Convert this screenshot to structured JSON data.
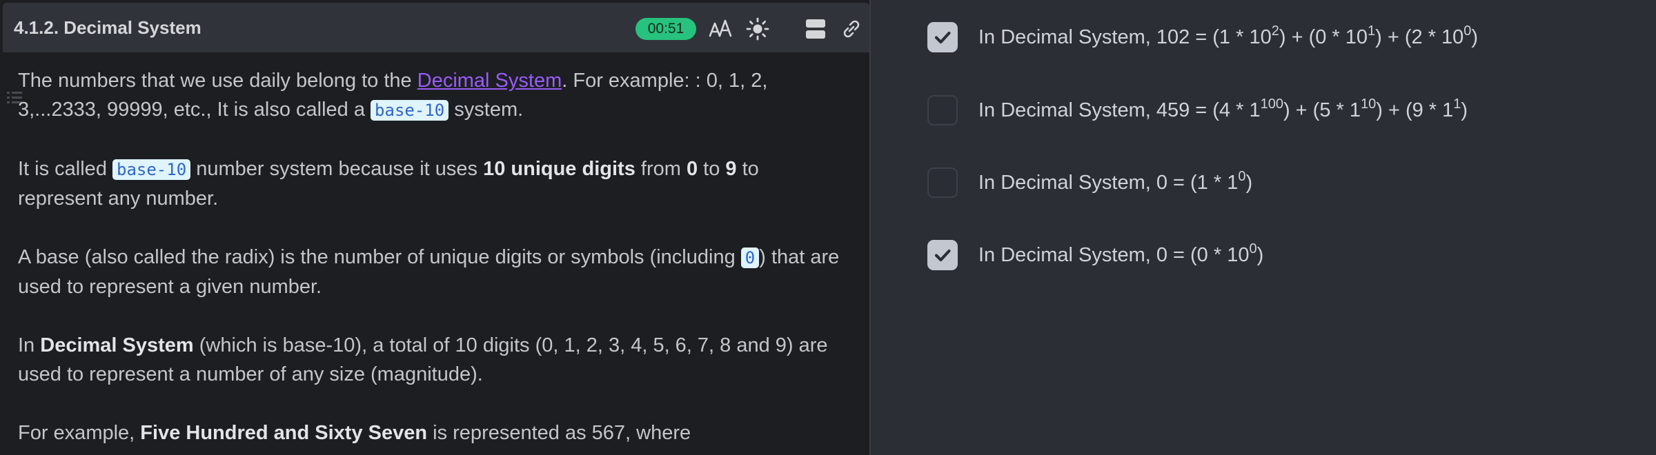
{
  "header": {
    "title": "4.1.2. Decimal System",
    "timer": "00:51",
    "icons": [
      "font-size-icon",
      "theme-sun-icon",
      "layout-icon",
      "link-icon"
    ]
  },
  "content": {
    "p1": {
      "t1": "The numbers that we use daily belong to the ",
      "link": "Decimal System",
      "t2": ". For example: : 0, 1, 2, 3,...2333, 99999, etc., It is also called a ",
      "code": "base-10",
      "t3": " system."
    },
    "p2": {
      "t1": "It is called ",
      "code": "base-10",
      "t2": " number system because it uses ",
      "b1": "10 unique digits",
      "t3": " from ",
      "b2": "0",
      "t4": " to ",
      "b3": "9",
      "t5": " to represent any number."
    },
    "p3": {
      "t1": "A base (also called the radix) is the number of unique digits or symbols (including ",
      "code": "0",
      "t2": ") that are used to represent a given number."
    },
    "p4": {
      "t1": "In ",
      "b1": "Decimal System",
      "t2": " (which is base-10), a total of 10 digits (0, 1, 2, 3, 4, 5, 6, 7, 8 and 9) are used to represent a number of any size (magnitude)."
    },
    "p5": {
      "t1": "For example, ",
      "b1": "Five Hundred and Sixty Seven",
      "t2": " is represented as 567, where"
    }
  },
  "options": [
    {
      "checked": true,
      "a": "In Decimal System, 102 = (1 * 10",
      "s1": "2",
      "b": ") + (0 * 10",
      "s2": "1",
      "c": ") + (2 * 10",
      "s3": "0",
      "d": ")"
    },
    {
      "checked": false,
      "a": "In Decimal System, 459 = (4 * 1",
      "s1": "100",
      "b": ") + (5 * 1",
      "s2": "10",
      "c": ") + (9 * 1",
      "s3": "1",
      "d": ")"
    },
    {
      "checked": false,
      "a": "In Decimal System, 0 = (1 * 1",
      "s1": "0",
      "b": ")"
    },
    {
      "checked": true,
      "a": "In Decimal System, 0 = (0 * 10",
      "s1": "0",
      "b": ")"
    }
  ],
  "colors": {
    "timer": "#27c27d",
    "link": "#9a5cf7",
    "code_bg": "#dff4fb",
    "code_text": "#3067c7"
  }
}
